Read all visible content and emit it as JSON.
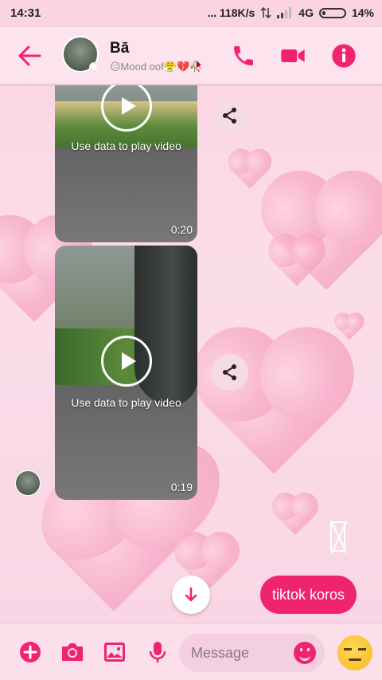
{
  "status_bar": {
    "time": "14:31",
    "network_speed": "... 118K/s",
    "network_type": "4G",
    "battery": "14%"
  },
  "header": {
    "contact_name": "Bā",
    "contact_status": "😑Mood oof😤💔🥀",
    "icons": [
      "back-arrow-icon",
      "phone-icon",
      "video-call-icon",
      "info-icon"
    ]
  },
  "messages": [
    {
      "type": "video",
      "overlay_label": "Use data to play video",
      "duration": "0:20"
    },
    {
      "type": "video",
      "overlay_label": "Use data to play video",
      "duration": "0:19"
    },
    {
      "type": "text",
      "sender": "me",
      "text": "tiktok koros"
    }
  ],
  "composer": {
    "placeholder": "Message",
    "icons": [
      "plus-icon",
      "camera-icon",
      "image-icon",
      "mic-icon",
      "emoji-icon",
      "unamused-emoji-icon"
    ]
  },
  "colors": {
    "accent": "#f0246e",
    "header_bg": "#fce3ee",
    "background": "#fbd3e3"
  }
}
